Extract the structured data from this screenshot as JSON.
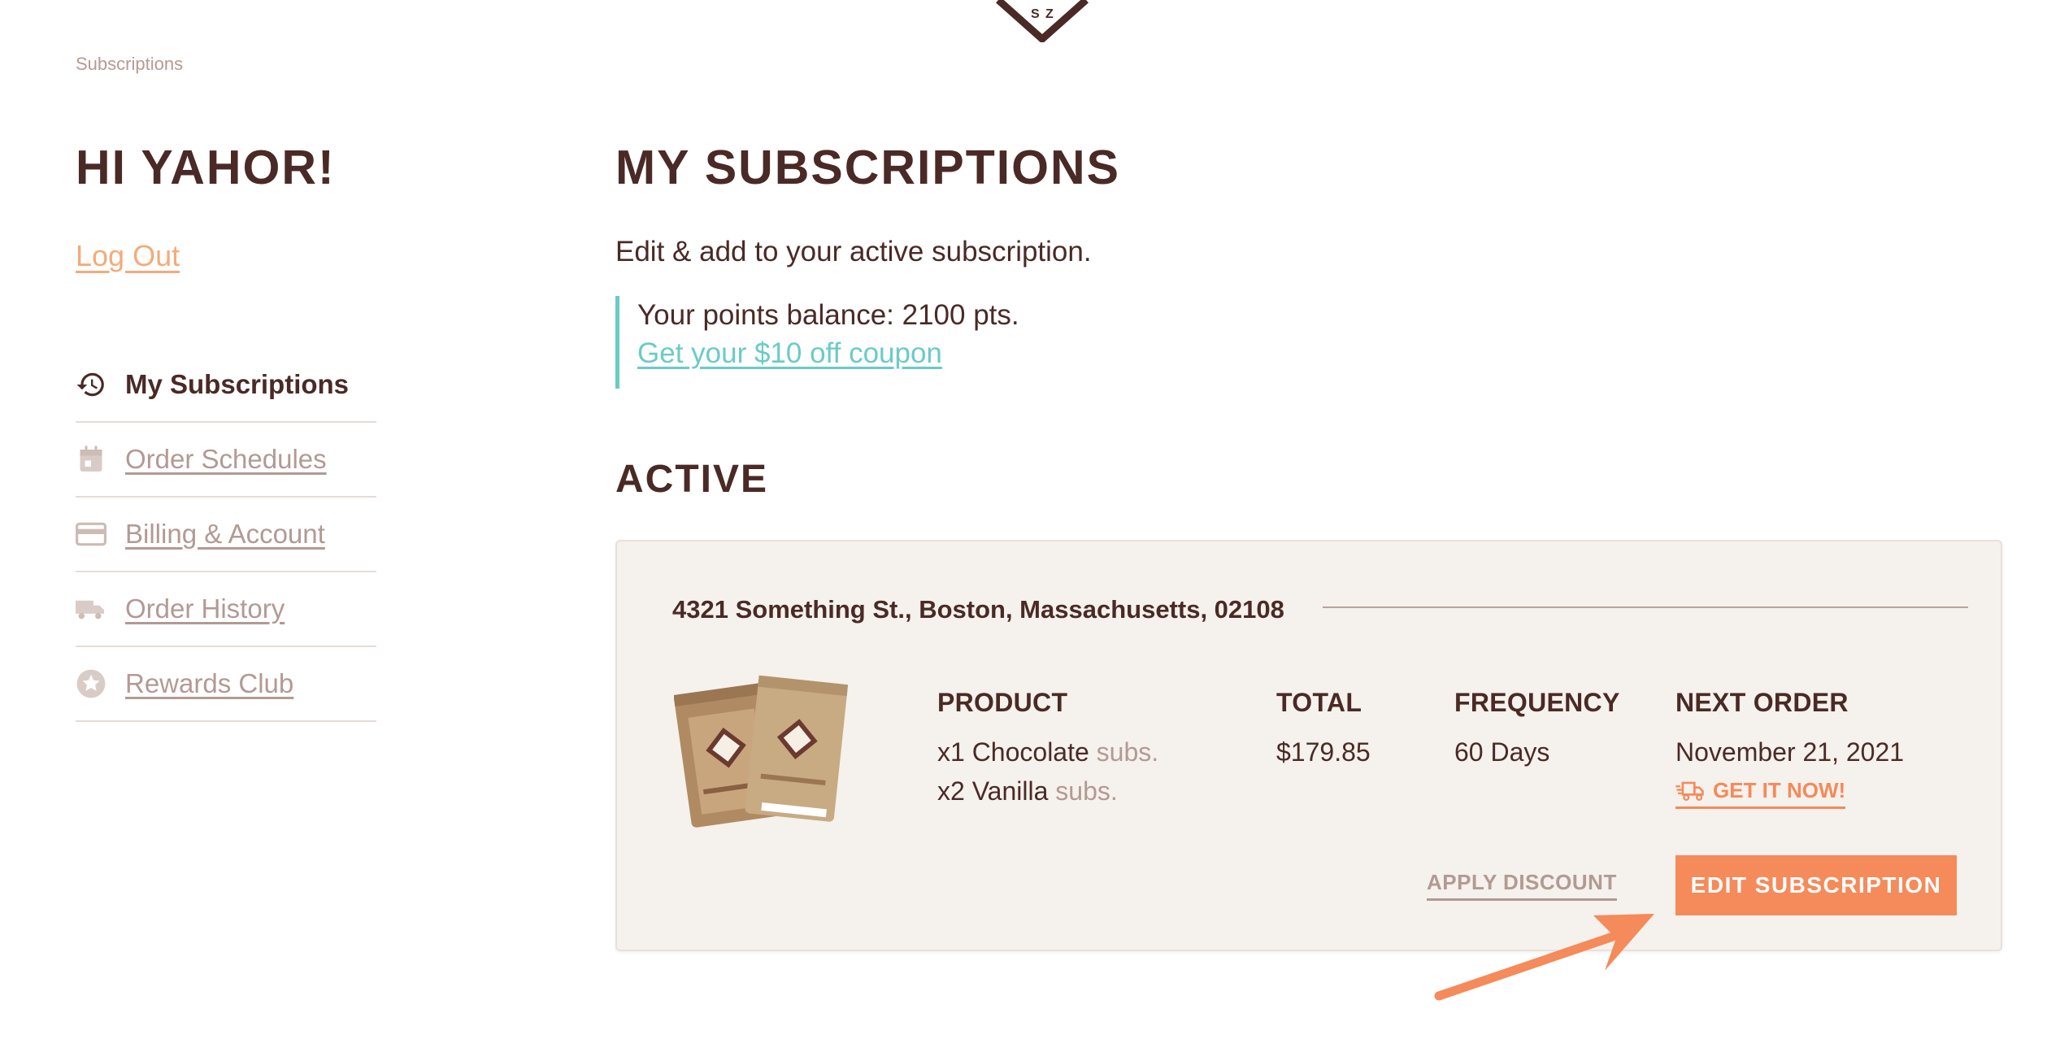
{
  "breadcrumb": "Subscriptions",
  "sidebar": {
    "greeting": "HI YAHOR!",
    "logout": "Log Out",
    "items": [
      {
        "label": "My Subscriptions",
        "icon": "history-icon",
        "active": true
      },
      {
        "label": "Order Schedules",
        "icon": "calendar-icon",
        "active": false
      },
      {
        "label": "Billing & Account",
        "icon": "credit-card-icon",
        "active": false
      },
      {
        "label": "Order History",
        "icon": "truck-icon",
        "active": false
      },
      {
        "label": "Rewards Club",
        "icon": "star-icon",
        "active": false
      }
    ]
  },
  "main": {
    "title": "MY SUBSCRIPTIONS",
    "intro": "Edit & add to your active subscription.",
    "points": {
      "balance_text": "Your points balance: 2100 pts.",
      "coupon_link": "Get your $10 off coupon"
    },
    "active_heading": "ACTIVE"
  },
  "subscription": {
    "address": "4321 Something St., Boston, Massachusetts, 02108",
    "columns": {
      "product": "PRODUCT",
      "total": "TOTAL",
      "frequency": "FREQUENCY",
      "next_order": "NEXT ORDER"
    },
    "products": [
      {
        "qty_name": "x1 Chocolate",
        "suffix": "subs."
      },
      {
        "qty_name": "x2 Vanilla",
        "suffix": "subs."
      }
    ],
    "total": "$179.85",
    "frequency": "60 Days",
    "next_order_date": "November 21, 2021",
    "get_it_now": "GET IT NOW!",
    "apply_discount": "APPLY DISCOUNT",
    "edit_button": "EDIT SUBSCRIPTION"
  },
  "colors": {
    "brand_brown": "#4a2a26",
    "accent_orange": "#f58a5a",
    "teal": "#6bcbc6",
    "muted": "#b29a93",
    "card_bg": "#f5f1ec"
  }
}
